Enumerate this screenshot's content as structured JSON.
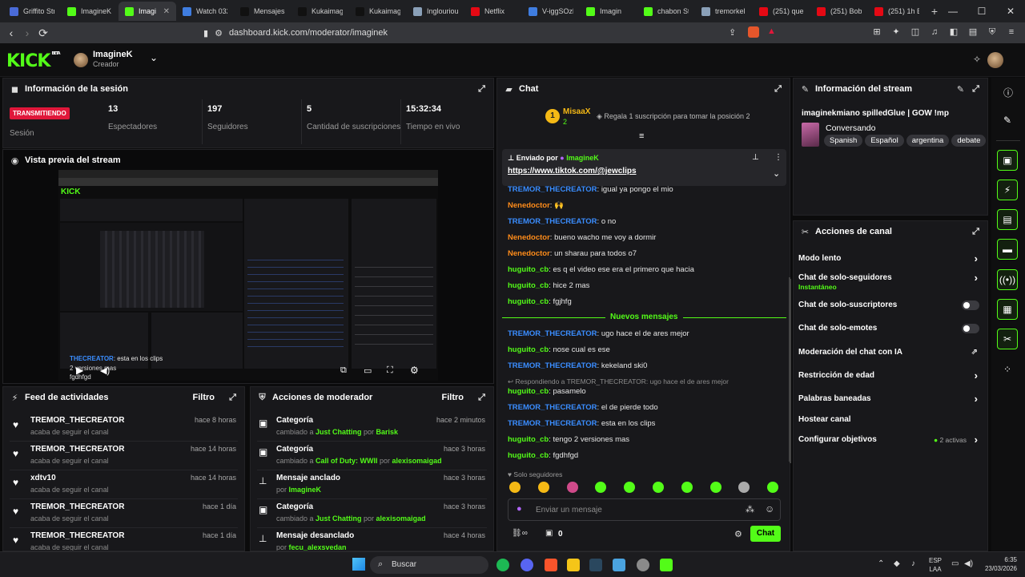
{
  "browser": {
    "tabs": [
      {
        "label": "Griffito Str",
        "color": "#4a6bd8"
      },
      {
        "label": "ImagineK",
        "color": "#53fc18"
      },
      {
        "label": "Imagi",
        "color": "#53fc18",
        "active": true
      },
      {
        "label": "Watch 032",
        "color": "#3f7de0"
      },
      {
        "label": "Mensajes |",
        "color": "#111111"
      },
      {
        "label": "Kukaimag",
        "color": "#111111"
      },
      {
        "label": "Kukaimagi",
        "color": "#111111"
      },
      {
        "label": "Inglouriou",
        "color": "#8aa0b8"
      },
      {
        "label": "Netflix",
        "color": "#e50914"
      },
      {
        "label": "V-iggSOzh",
        "color": "#3f7de0"
      },
      {
        "label": "Imagin",
        "color": "#53fc18"
      },
      {
        "label": "chabon Str",
        "color": "#53fc18"
      },
      {
        "label": "tremorkel",
        "color": "#8aa0b8"
      },
      {
        "label": "(251) que",
        "color": "#e50914"
      },
      {
        "label": "(251) Bob",
        "color": "#e50914"
      },
      {
        "label": "(251) 1h B",
        "color": "#e50914"
      }
    ],
    "new_tab": "+",
    "url": "dashboard.kick.com/moderator/imaginek"
  },
  "header": {
    "logo": "KICK",
    "beta": "BETA",
    "user_name": "ImagineK",
    "user_role": "Creador"
  },
  "session": {
    "title": "Información de la sesión",
    "live_badge": "TRANSMITIENDO",
    "session_label": "Sesión",
    "stats": [
      {
        "value": "13",
        "label": "Espectadores"
      },
      {
        "value": "197",
        "label": "Seguidores"
      },
      {
        "value": "5",
        "label": "Cantidad de suscripciones"
      },
      {
        "value": "15:32:34",
        "label": "Tiempo en vivo"
      }
    ]
  },
  "preview": {
    "title": "Vista previa del stream",
    "overlay_user": "THECREATOR",
    "overlay_text": ": esta en los clips",
    "overlay2": "2 versiones mas",
    "overlay3": "fgdhfgd"
  },
  "activity": {
    "title": "Feed de actividades",
    "filter": "Filtro",
    "items": [
      {
        "name": "TREMOR_THECREATOR",
        "sub": "acaba de seguir el canal",
        "time": "hace 8 horas"
      },
      {
        "name": "TREMOR_THECREATOR",
        "sub": "acaba de seguir el canal",
        "time": "hace 14 horas"
      },
      {
        "name": "xdtv10",
        "sub": "acaba de seguir el canal",
        "time": "hace 14 horas"
      },
      {
        "name": "TREMOR_THECREATOR",
        "sub": "acaba de seguir el canal",
        "time": "hace 1 día"
      },
      {
        "name": "TREMOR_THECREATOR",
        "sub": "acaba de seguir el canal",
        "time": "hace 1 día"
      }
    ]
  },
  "modactions": {
    "title": "Acciones de moderador",
    "filter": "Filtro",
    "items": [
      {
        "name": "Categoría",
        "pre": "cambiado a ",
        "hl": "Just Chatting",
        "mid": " por ",
        "by": "Barisk",
        "time": "hace 2 minutos",
        "icon": "▣"
      },
      {
        "name": "Categoría",
        "pre": "cambiado a ",
        "hl": "Call of Duty: WWII",
        "mid": " por ",
        "by": "alexisomaigad",
        "time": "hace 3 horas",
        "icon": "▣"
      },
      {
        "name": "Mensaje anclado",
        "pre": "por ",
        "hl": "ImagineK",
        "mid": "",
        "by": "",
        "time": "hace 3 horas",
        "icon": "⊥"
      },
      {
        "name": "Categoría",
        "pre": "cambiado a ",
        "hl": "Just Chatting",
        "mid": " por ",
        "by": "alexisomaigad",
        "time": "hace 3 horas",
        "icon": "▣"
      },
      {
        "name": "Mensaje desanclado",
        "pre": "por ",
        "hl": "fecu_alexsvedan",
        "mid": "",
        "by": "",
        "time": "hace 4 horas",
        "icon": "⊥"
      }
    ]
  },
  "chat": {
    "title": "Chat",
    "top_user": "MisaaX",
    "top_count": "2",
    "top_rank": "1",
    "top_text": "Regala 1 suscripción para tomar la posición 2",
    "pinned_by_label": "Enviado por",
    "pinned_by": "ImagineK",
    "pinned_link": "https://www.tiktok.com/@jewclips",
    "messages": [
      {
        "user": "TREMOR_THECREATOR",
        "cls": "u-b",
        "text": ": igual ya pongo el mio"
      },
      {
        "user": "Nenedoctor",
        "cls": "u-o",
        "text": ": 🙌"
      },
      {
        "user": "TREMOR_THECREATOR",
        "cls": "u-b",
        "text": ": o no"
      },
      {
        "user": "Nenedoctor",
        "cls": "u-o",
        "text": ": bueno wacho me voy a dormir"
      },
      {
        "user": "Nenedoctor",
        "cls": "u-o",
        "text": ": un sharau para todos o7"
      },
      {
        "user": "huguito_cb",
        "cls": "u-g",
        "text": ": es q el video ese era el primero que hacia"
      },
      {
        "user": "huguito_cb",
        "cls": "u-g",
        "text": ": hice 2 mas"
      },
      {
        "user": "huguito_cb",
        "cls": "u-g",
        "text": ": fgjhfg"
      }
    ],
    "new_label": "Nuevos mensajes",
    "messages2": [
      {
        "user": "TREMOR_THECREATOR",
        "cls": "u-b",
        "text": ": ugo hace el de ares mejor"
      },
      {
        "user": "huguito_cb",
        "cls": "u-g",
        "text": ": nose cual es ese"
      },
      {
        "user": "TREMOR_THECREATOR",
        "cls": "u-b",
        "text": ": kekeland ski0"
      }
    ],
    "reply_note": "Respondiendo a TREMOR_THECREATOR: ugo hace el de ares mejor",
    "messages3": [
      {
        "user": "huguito_cb",
        "cls": "u-g",
        "text": ": pasamelo"
      },
      {
        "user": "TREMOR_THECREATOR",
        "cls": "u-b",
        "text": ": el de pierde todo"
      },
      {
        "user": "TREMOR_THECREATOR",
        "cls": "u-b",
        "text": ": esta en los clips"
      },
      {
        "user": "huguito_cb",
        "cls": "u-g",
        "text": ": tengo 2 versiones mas"
      },
      {
        "user": "huguito_cb",
        "cls": "u-g",
        "text": ": fgdhfgd"
      }
    ],
    "followers_only": "Solo seguidores",
    "input_placeholder": "Enviar un mensaje",
    "count": "0",
    "send": "Chat"
  },
  "stream_info": {
    "title": "Información del stream",
    "stream_title": "imaginekmiano spilledGlue | GOW !mp",
    "category": "Conversando",
    "tags": [
      "Spanish",
      "Español",
      "argentina",
      "debate"
    ]
  },
  "channel_actions": {
    "title": "Acciones de canal",
    "items": [
      {
        "label": "Modo lento",
        "type": "chev"
      },
      {
        "label": "Chat de solo-seguidores",
        "sub": "Instantáneo",
        "type": "chev"
      },
      {
        "label": "Chat de solo-suscriptores",
        "type": "toggle"
      },
      {
        "label": "Chat de solo-emotes",
        "type": "toggle"
      },
      {
        "label": "Moderación del chat con IA",
        "type": "ext"
      },
      {
        "label": "Restricción de edad",
        "type": "chev"
      },
      {
        "label": "Palabras baneadas",
        "type": "chev"
      },
      {
        "label": "Hostear canal",
        "type": "none"
      },
      {
        "label": "Configurar objetivos",
        "type": "goal",
        "extra": "2 activas"
      }
    ]
  },
  "taskbar": {
    "search": "Buscar",
    "lang1": "ESP",
    "lang2": "LAA",
    "time": "6:35",
    "date": "23/03/2026"
  }
}
